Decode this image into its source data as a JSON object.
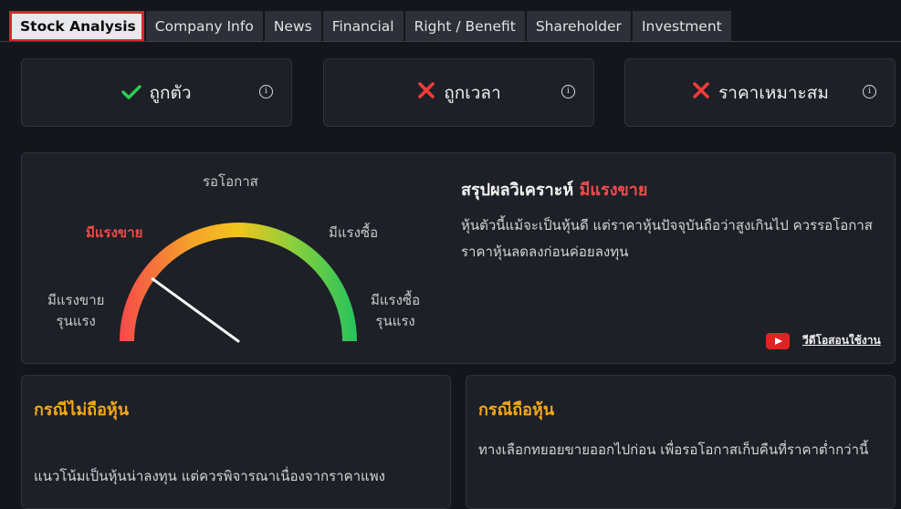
{
  "tabs": [
    "Stock Analysis",
    "Company Info",
    "News",
    "Financial",
    "Right / Benefit",
    "Shareholder",
    "Investment"
  ],
  "criteria": [
    {
      "label": "ถูกตัว",
      "status": "pass",
      "icon": "check-icon",
      "color": "#2ecc52"
    },
    {
      "label": "ถูกเวลา",
      "status": "fail",
      "icon": "cross-icon",
      "color": "#f23b3b"
    },
    {
      "label": "ราคาเหมาะสม",
      "status": "fail",
      "icon": "cross-icon",
      "color": "#f23b3b"
    }
  ],
  "info_icon": "i",
  "gauge": {
    "level": 0.2,
    "labels": {
      "neutral": "รอโอกาส",
      "sell": "มีแรงขาย",
      "buy": "มีแรงซื้อ",
      "strong_sell_1": "มีแรงขาย",
      "strong_sell_2": "รุนแรง",
      "strong_buy_1": "มีแรงซื้อ",
      "strong_buy_2": "รุนแรง"
    },
    "active_color": "#f04848"
  },
  "summary": {
    "title": "สรุปผลวิเคราะห์",
    "verdict": "มีแรงขาย",
    "body": "หุ้นตัวนี้แม้จะเป็นหุ้นดี แต่ราคาหุ้นปัจจุบันถือว่าสูงเกินไป ควรรอโอกาสราคาหุ้นลดลงก่อนค่อยลงทุน",
    "video_label": "วีดีโอสอนใช้งาน"
  },
  "cases": {
    "not_holding": {
      "title": "กรณีไม่ถือหุ้น",
      "body": "แนวโน้มเป็นหุ้นน่าลงทุน แต่ควรพิจารณาเนื่องจากราคาแพง"
    },
    "holding": {
      "title": "กรณีถือหุ้น",
      "body": "ทางเลือกทยอยขายออกไปก่อน เพื่อรอโอกาสเก็บคืนที่ราคาต่ำกว่านี้"
    }
  },
  "colors": {
    "accent_red": "#d8262b",
    "highlight_orange": "#f2a71b"
  }
}
